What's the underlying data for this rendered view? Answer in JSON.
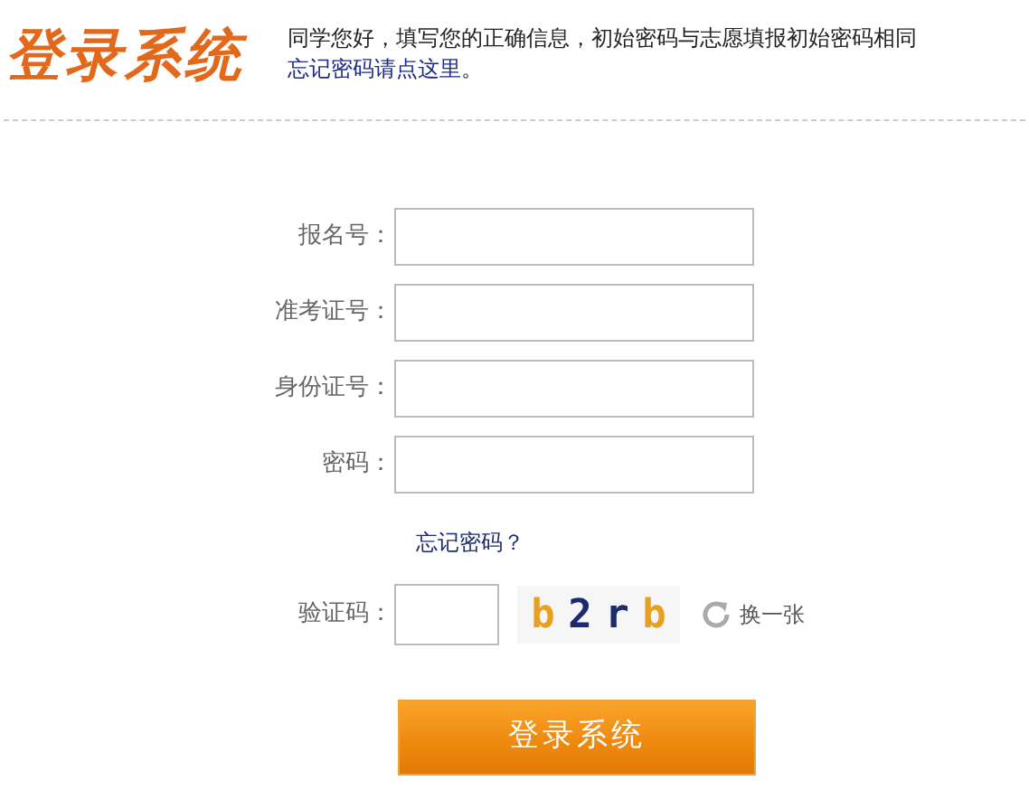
{
  "header": {
    "title": "登录系统",
    "intro": "同学您好，填写您的正确信息，初始密码与志愿填报初始密码相同",
    "forgot_link": "忘记密码请点这里",
    "forgot_suffix": "。"
  },
  "fields": [
    {
      "label": "报名号："
    },
    {
      "label": "准考证号："
    },
    {
      "label": "身份证号："
    },
    {
      "label": "密码："
    }
  ],
  "forgot_password": "忘记密码？",
  "captcha": {
    "label": "验证码：",
    "chars": [
      "b",
      "2",
      "r",
      "b"
    ],
    "refresh": "换一张"
  },
  "submit": "登录系统"
}
